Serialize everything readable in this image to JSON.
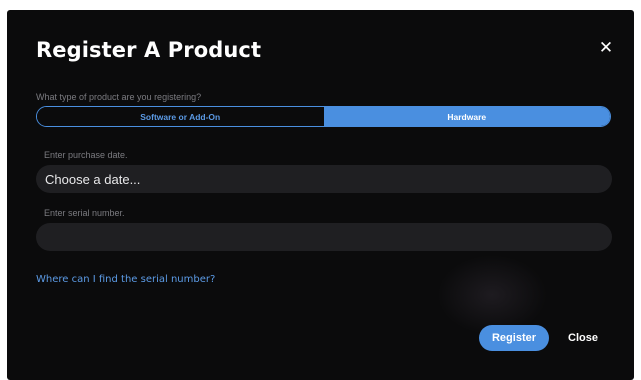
{
  "dialog": {
    "title": "Register A Product",
    "close_icon": "close-icon"
  },
  "product_type": {
    "question": "What type of product are you registering?",
    "options": [
      {
        "label": "Software or Add-On",
        "selected": false
      },
      {
        "label": "Hardware",
        "selected": true
      }
    ]
  },
  "purchase_date": {
    "label": "Enter purchase date.",
    "placeholder": "Choose a date..."
  },
  "serial_number": {
    "label": "Enter serial number.",
    "placeholder": ""
  },
  "help_link": "Where can I find the serial number?",
  "actions": {
    "register_label": "Register",
    "close_label": "Close"
  },
  "colors": {
    "background": "#0b0b0c",
    "accent": "#4a8fe0",
    "field_bg": "#1f1f22",
    "muted_text": "#7b7b80"
  }
}
